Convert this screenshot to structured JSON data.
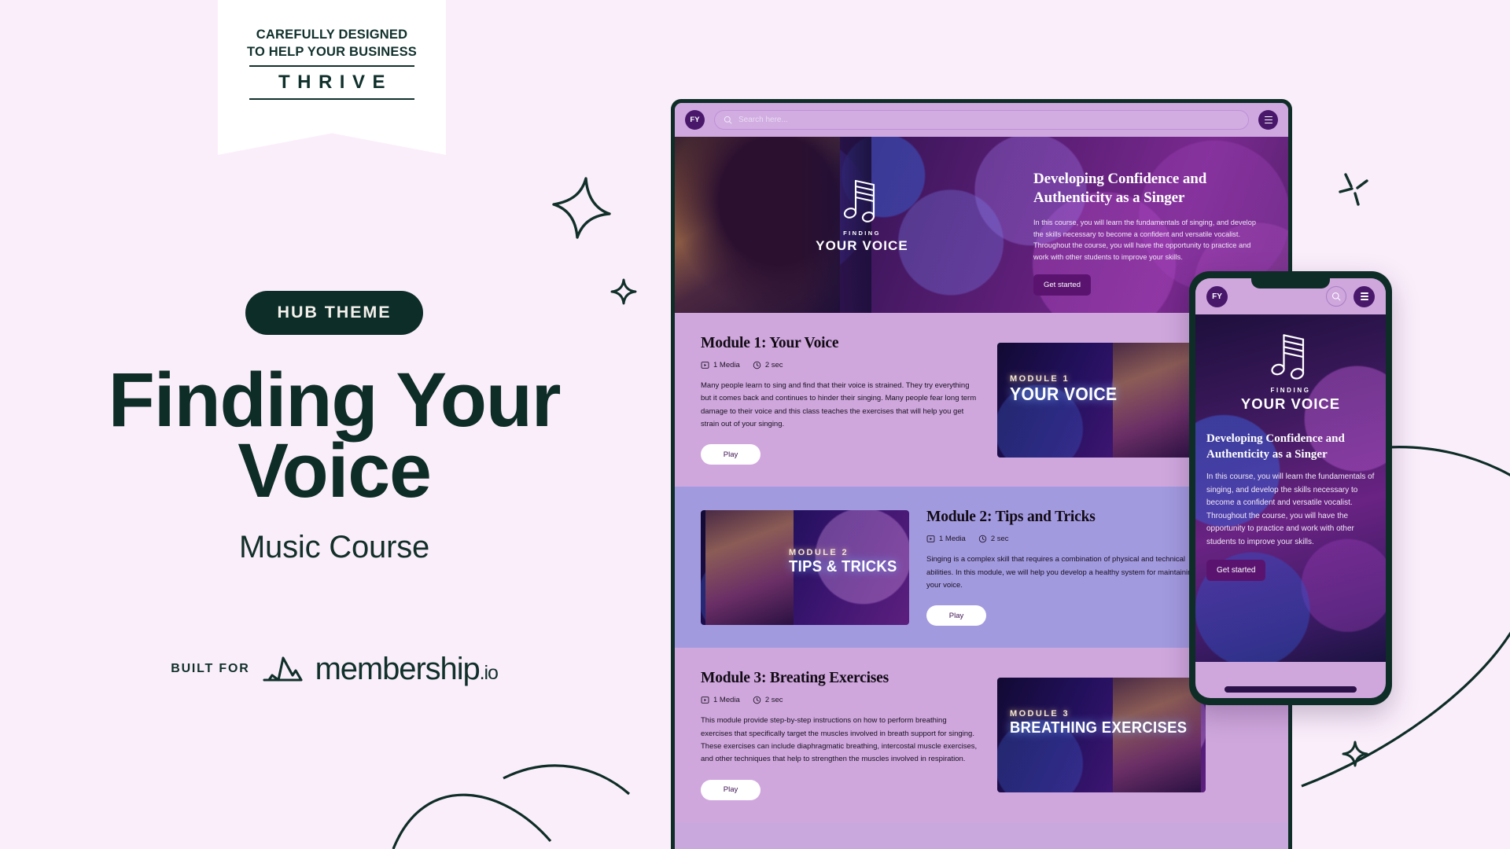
{
  "theme": {
    "bg": "#fbeefb",
    "ink": "#0e2d27",
    "accent_purple": "#5a1470",
    "lavender": "#cfa7dd",
    "periwinkle": "#a29adf"
  },
  "ribbon": {
    "line1": "CAREFULLY DESIGNED",
    "line2": "TO HELP YOUR BUSINESS",
    "word": "THRIVE"
  },
  "marketing": {
    "pill": "HUB THEME",
    "headline": "Finding Your Voice",
    "subhead": "Music Course",
    "built_for_label": "BUILT FOR",
    "brand_name": "membership",
    "brand_tld": ".io"
  },
  "desktop": {
    "topbar": {
      "avatar_initials": "FY",
      "search_placeholder": "Search here...",
      "search_icon": "search-icon",
      "menu_icon": "hamburger-icon"
    },
    "hero": {
      "logo_sub": "FINDING",
      "logo_main": "YOUR VOICE",
      "title": "Developing Confidence and Authenticity as a Singer",
      "body": "In this course, you will learn the fundamentals of singing, and develop the skills necessary to become a confident and versatile vocalist. Throughout the course, you will have the opportunity to practice and work with other students to improve your skills.",
      "cta": "Get started"
    },
    "modules": [
      {
        "title": "Module 1: Your Voice",
        "media_count": "1 Media",
        "duration": "2 sec",
        "body": "Many people learn to sing and find that their voice is strained. They try everything but it comes back and continues to hinder their singing. Many people fear long term damage to their voice and this class teaches the exercises that will help you get strain out of your singing.",
        "cta": "Play",
        "thumb_kicker": "MODULE  1",
        "thumb_main": "YOUR VOICE"
      },
      {
        "title": "Module 2: Tips and Tricks",
        "media_count": "1 Media",
        "duration": "2 sec",
        "body": "Singing is a complex skill that requires a combination of physical and technical abilities. In this module, we will help you develop a healthy system for maintaining your voice.",
        "cta": "Play",
        "thumb_kicker": "MODULE  2",
        "thumb_main": "TIPS & TRICKS"
      },
      {
        "title": "Module 3: Breating Exercises",
        "media_count": "1 Media",
        "duration": "2 sec",
        "body": "This module provide step-by-step instructions on how to perform breathing exercises that specifically target the muscles involved in breath support for singing. These exercises can include diaphragmatic breathing, intercostal muscle exercises, and other techniques that help to strengthen the muscles involved in respiration.",
        "cta": "Play",
        "thumb_kicker": "MODULE  3",
        "thumb_main": "BREATHING EXERCISES"
      }
    ]
  },
  "phone": {
    "avatar_initials": "FY",
    "search_icon": "search-icon",
    "menu_icon": "hamburger-icon",
    "logo_sub": "FINDING",
    "logo_main": "YOUR VOICE",
    "title": "Developing Confidence and Authenticity as a Singer",
    "body": "In this course, you will learn the fundamentals of singing, and develop the skills necessary to become a confident and versatile vocalist. Throughout the course, you will have the opportunity to practice and work with other students to improve your skills.",
    "cta": "Get started"
  },
  "decorations": {
    "star_large": "four-point-star-icon",
    "star_small": "four-point-star-icon",
    "sparkle": "sparkle-icon"
  }
}
